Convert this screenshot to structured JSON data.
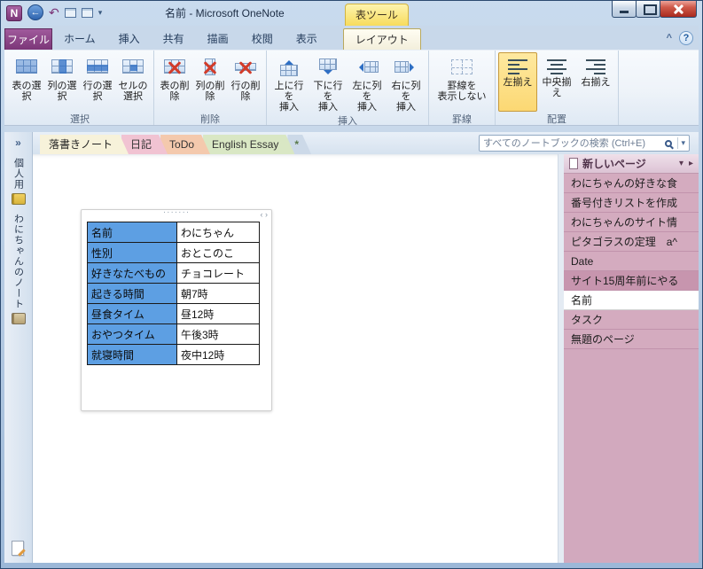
{
  "titlebar": {
    "app_icon": "N",
    "title": "名前 - Microsoft OneNote",
    "contextual_group": "表ツール"
  },
  "glyphs": {
    "back": "←",
    "undo": "↶",
    "qat_dropdown": "▾",
    "collapse_ribbon": "^",
    "help": "?",
    "expand_sidebar": "»",
    "new_section_star": "*",
    "drag_dots": "·······",
    "nav_arrows": "‹ ›",
    "dropdown": "▾",
    "expand_right": "▸"
  },
  "ribbon": {
    "file_tab": "ファイル",
    "tabs": [
      "ホーム",
      "挿入",
      "共有",
      "描画",
      "校閲",
      "表示"
    ],
    "layout_tab": "レイアウト",
    "select_group": {
      "label": "選択",
      "buttons": [
        "表の選択",
        "列の選択",
        "行の選択",
        "セルの\n選択"
      ]
    },
    "delete_group": {
      "label": "削除",
      "buttons": [
        "表の削除",
        "列の削除",
        "行の削除"
      ]
    },
    "insert_group": {
      "label": "挿入",
      "buttons": [
        "上に行を\n挿入",
        "下に行を\n挿入",
        "左に列を\n挿入",
        "右に列を\n挿入"
      ]
    },
    "border_group": {
      "label": "罫線",
      "buttons": [
        "罫線を\n表示しない"
      ]
    },
    "align_group": {
      "label": "配置",
      "buttons": [
        "左揃え",
        "中央揃え",
        "右揃え"
      ],
      "selected": "左揃え"
    }
  },
  "section_tabs": [
    "落書きノート",
    "日記",
    "ToDo",
    "English Essay"
  ],
  "search": {
    "placeholder": "すべてのノートブックの検索 (Ctrl+E)"
  },
  "nav_sidebar": {
    "items": [
      "個人用",
      "わにちゃんのノート"
    ]
  },
  "page_pane": {
    "new_page_label": "新しいページ",
    "pages": [
      "わにちゃんの好きな食",
      "番号付きリストを作成",
      "わにちゃんのサイト情",
      "ピタゴラスの定理　a^",
      "Date",
      "サイト15周年前にやる",
      "名前",
      "タスク",
      "無題のページ"
    ],
    "selected": "名前"
  },
  "page": {
    "table": {
      "rows": [
        {
          "label": "名前",
          "value": "わにちゃん"
        },
        {
          "label": "性別",
          "value": "おとこのこ"
        },
        {
          "label": "好きなたべもの",
          "value": "チョコレート"
        },
        {
          "label": "起きる時間",
          "value": "朝7時"
        },
        {
          "label": "昼食タイム",
          "value": "昼12時"
        },
        {
          "label": "おやつタイム",
          "value": "午後3時"
        },
        {
          "label": "就寝時間",
          "value": "夜中12時"
        }
      ]
    }
  },
  "colors": {
    "selection_blue": "#5d9fe3",
    "pane_pink": "#d2a9be",
    "file_tab_purple": "#7b3678",
    "contextual_yellow": "#f7dc5c",
    "active_section_tab_cream": "#f7f2da"
  }
}
